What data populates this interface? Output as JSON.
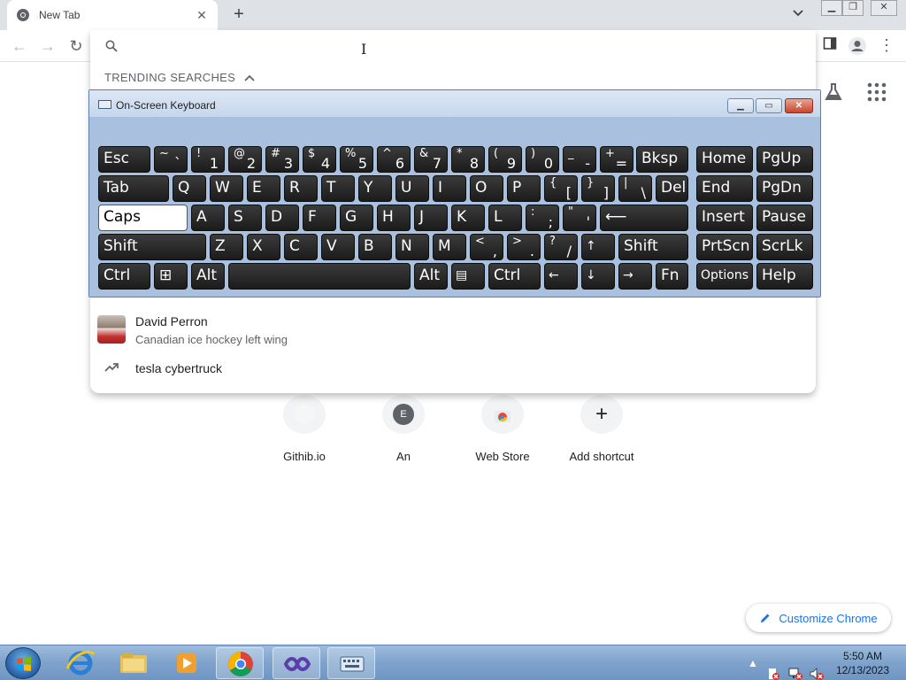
{
  "browser": {
    "tab": {
      "title": "New Tab"
    },
    "icons": [
      "chrome-favicon",
      "close-icon",
      "plus-icon",
      "chevron-down-icon",
      "back-icon",
      "forward-icon",
      "reload-icon",
      "side-panel-icon",
      "profile-icon",
      "more-icon"
    ]
  },
  "omnibox": {
    "trending_header": "TRENDING SEARCHES",
    "suggestions": [
      {
        "title": "David Perron",
        "subtitle": "Canadian ice hockey left wing"
      },
      {
        "title": "tesla cybertruck"
      }
    ]
  },
  "osk": {
    "title": "On-Screen Keyboard",
    "rows": [
      [
        {
          "top": "~",
          "bot": "`"
        },
        {
          "top": "!",
          "bot": "1"
        },
        {
          "top": "@",
          "bot": "2"
        },
        {
          "top": "#",
          "bot": "3"
        },
        {
          "top": "$",
          "bot": "4"
        },
        {
          "top": "%",
          "bot": "5"
        },
        {
          "top": "^",
          "bot": "6"
        },
        {
          "top": "&",
          "bot": "7"
        },
        {
          "top": "*",
          "bot": "8"
        },
        {
          "top": "(",
          "bot": "9"
        },
        {
          "top": ")",
          "bot": "0"
        },
        {
          "top": "_",
          "bot": "-"
        },
        {
          "top": "+",
          "bot": "="
        }
      ],
      [
        "Q",
        "W",
        "E",
        "R",
        "T",
        "Y",
        "U",
        "I",
        "O",
        "P",
        {
          "top": "{",
          "bot": "["
        },
        {
          "top": "}",
          "bot": "]"
        },
        {
          "top": "|",
          "bot": "\\"
        }
      ],
      [
        "A",
        "S",
        "D",
        "F",
        "G",
        "H",
        "J",
        "K",
        "L",
        {
          "top": ":",
          "bot": ";"
        },
        {
          "top": "\"",
          "bot": "'"
        }
      ],
      [
        "Z",
        "X",
        "C",
        "V",
        "B",
        "N",
        "M",
        {
          "top": "<",
          "bot": ","
        },
        {
          "top": ">",
          "bot": "."
        },
        {
          "top": "?",
          "bot": "/"
        }
      ]
    ],
    "labels": {
      "esc": "Esc",
      "bksp": "Bksp",
      "home": "Home",
      "pgup": "PgUp",
      "tab": "Tab",
      "del": "Del",
      "end": "End",
      "pgdn": "PgDn",
      "caps": "Caps",
      "enter": "⟵",
      "insert": "Insert",
      "pause": "Pause",
      "shift": "Shift",
      "up": "↑",
      "prtscn": "PrtScn",
      "scrlk": "ScrLk",
      "ctrl": "Ctrl",
      "win": "⊞",
      "alt": "Alt",
      "menu": "▤",
      "left": "←",
      "down": "↓",
      "right": "→",
      "fn": "Fn",
      "options": "Options",
      "help": "Help"
    }
  },
  "ntp": {
    "shortcuts": [
      {
        "label": "Githib.io",
        "letter": ""
      },
      {
        "label": "An",
        "letter": "E"
      },
      {
        "label": "Web Store",
        "letter": ""
      },
      {
        "label": "Add shortcut",
        "letter": "+"
      }
    ],
    "customize": "Customize Chrome"
  },
  "taskbar": {
    "apps": [
      "internet-explorer-icon",
      "folder-icon",
      "media-player-icon",
      "chrome-icon",
      "visual-studio-icon",
      "on-screen-keyboard-icon"
    ],
    "clock_time": "5:50 AM",
    "clock_date": "12/13/2023"
  }
}
